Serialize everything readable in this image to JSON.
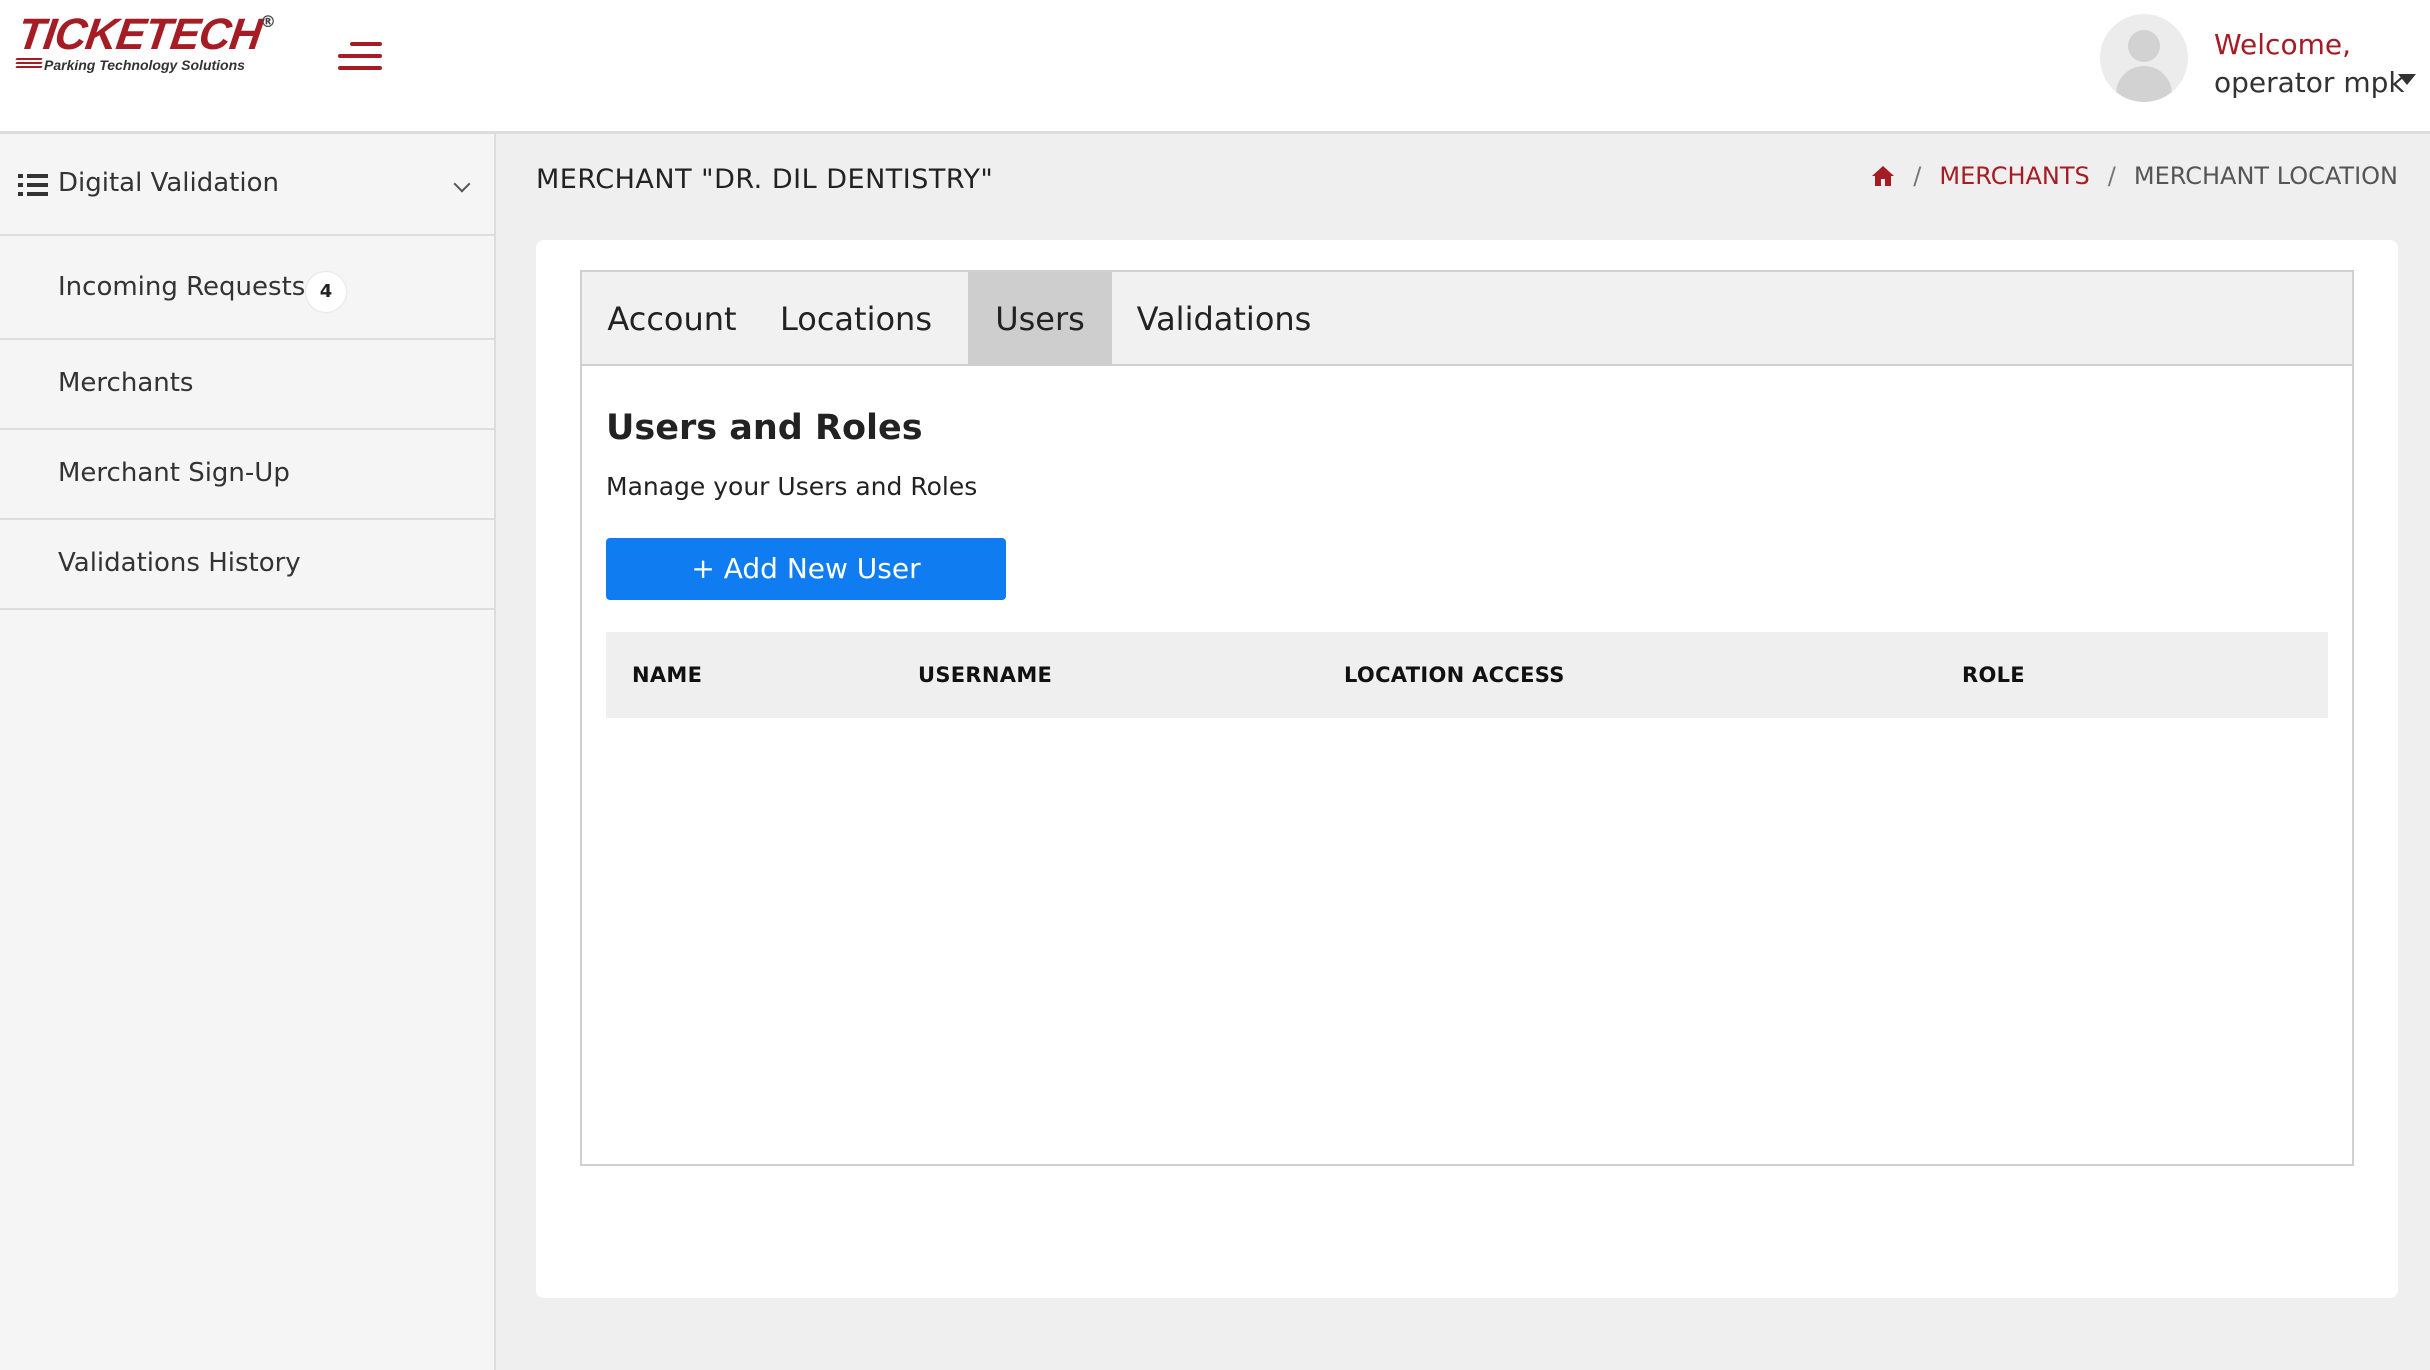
{
  "header": {
    "logo": {
      "wordmark": "TICKETECH",
      "registered": "®",
      "tagline": "Parking Technology Solutions"
    },
    "welcome_line1": "Welcome,",
    "welcome_line2": "operator mpk"
  },
  "sidebar": {
    "group_label": "Digital Validation",
    "items": [
      {
        "label": "Incoming Requests",
        "badge": "4"
      },
      {
        "label": "Merchants"
      },
      {
        "label": "Merchant Sign-Up"
      },
      {
        "label": "Validations History"
      }
    ]
  },
  "page": {
    "title": "MERCHANT \"DR. DIL DENTISTRY\"",
    "breadcrumb": {
      "home_icon": "home-icon",
      "separator": "/",
      "link": "MERCHANTS",
      "current": "MERCHANT LOCATION"
    }
  },
  "tabs": [
    {
      "label": "Account",
      "active": false
    },
    {
      "label": "Locations",
      "active": false
    },
    {
      "label": "Users",
      "active": true
    },
    {
      "label": "Validations",
      "active": false
    }
  ],
  "users": {
    "title": "Users and Roles",
    "subtitle": "Manage your Users and Roles",
    "add_button": "+ Add New User",
    "columns": [
      "NAME",
      "USERNAME",
      "LOCATION ACCESS",
      "ROLE"
    ],
    "rows": []
  },
  "colors": {
    "brand_red": "#a51c24",
    "primary_button": "#0f7cf2"
  }
}
